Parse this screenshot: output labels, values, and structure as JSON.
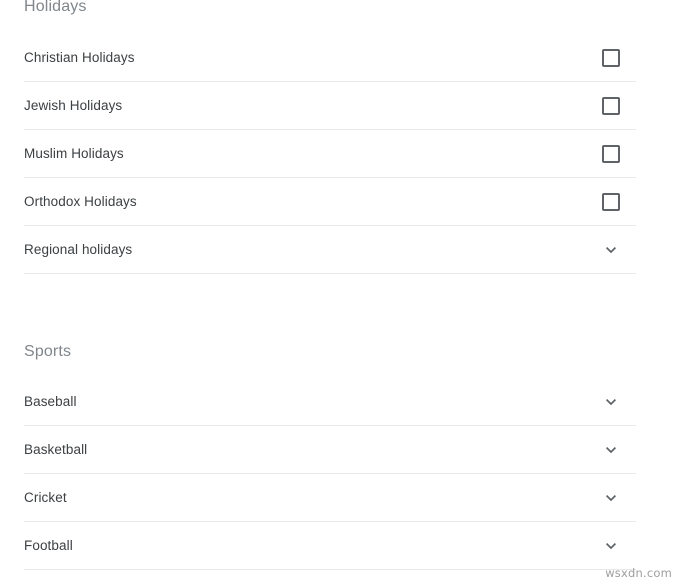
{
  "sections": [
    {
      "id": "holidays",
      "title": "Holidays",
      "rows": [
        {
          "label": "Christian Holidays",
          "control": "checkbox",
          "checked": false
        },
        {
          "label": "Jewish Holidays",
          "control": "checkbox",
          "checked": false
        },
        {
          "label": "Muslim Holidays",
          "control": "checkbox",
          "checked": false
        },
        {
          "label": "Orthodox Holidays",
          "control": "checkbox",
          "checked": false
        },
        {
          "label": "Regional holidays",
          "control": "chevron-down-icon"
        }
      ]
    },
    {
      "id": "sports",
      "title": "Sports",
      "rows": [
        {
          "label": "Baseball",
          "control": "chevron-down-icon"
        },
        {
          "label": "Basketball",
          "control": "chevron-down-icon"
        },
        {
          "label": "Cricket",
          "control": "chevron-down-icon"
        },
        {
          "label": "Football",
          "control": "chevron-down-icon"
        }
      ]
    }
  ],
  "watermark": "wsxdn.com",
  "colors": {
    "background": "#ffffff",
    "section_title": "#80868b",
    "row_label": "#3c4043",
    "divider": "#e8eaed",
    "checkbox_border": "#5f6368",
    "chevron": "#5f6368",
    "watermark": "#9e9e9e"
  }
}
